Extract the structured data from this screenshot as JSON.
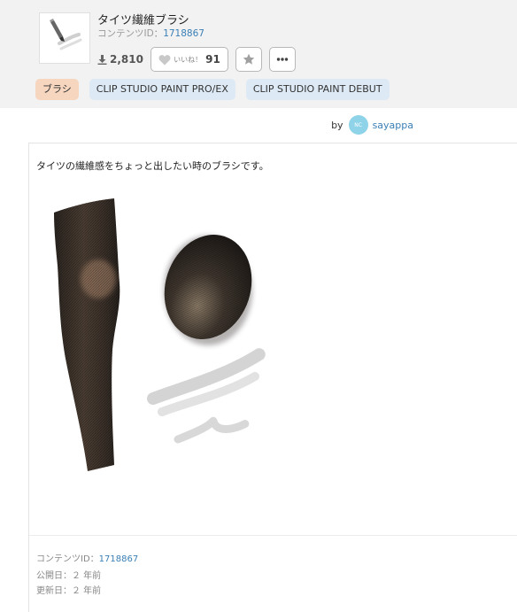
{
  "material": {
    "title": "タイツ繊維ブラシ",
    "content_id_label": "コンテンツID：",
    "content_id": "1718867",
    "download_count": "2,810",
    "like_label": "いいね！",
    "like_count": "91"
  },
  "tags": [
    "ブラシ",
    "CLIP STUDIO PAINT PRO/EX",
    "CLIP STUDIO PAINT DEBUT"
  ],
  "author": {
    "by_label": "by",
    "name": "sayappa"
  },
  "description": "タイツの繊維感をちょっと出したい時のブラシです。",
  "meta": {
    "content_id_label": "コンテンツID：",
    "content_id": "1718867",
    "published": "公開日：２ 年前",
    "updated": "更新日：２ 年前"
  },
  "icons": {
    "download": "download-icon",
    "like": "heart-icon",
    "favorite": "star-icon",
    "more": "more-icon"
  },
  "colors": {
    "link": "#3a7fb5",
    "tag_primary": "#f6d6bf",
    "tag_secondary": "#dde9f5",
    "header_bg": "#f2f2f2"
  }
}
